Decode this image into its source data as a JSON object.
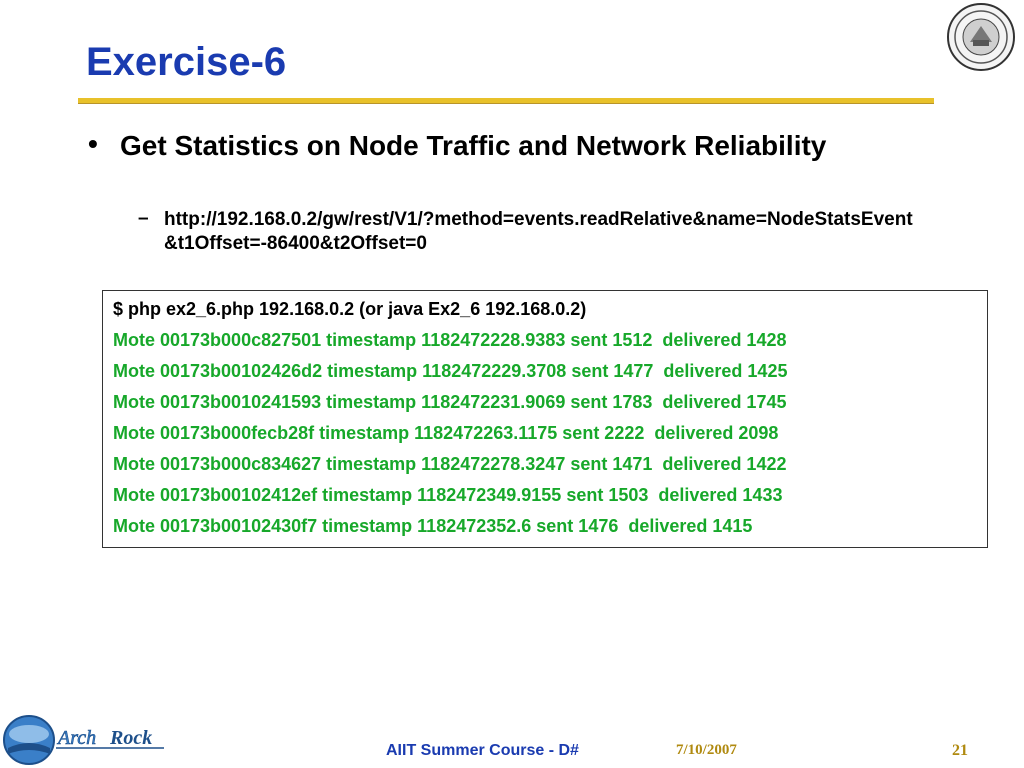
{
  "slide": {
    "title": "Exercise-6",
    "bullet": "Get Statistics on Node Traffic and Network Reliability",
    "sub_bullet": "http://192.168.0.2/gw/rest/V1/?method=events.readRelative&name=NodeStatsEvent&t1Offset=-86400&t2Offset=0"
  },
  "code": {
    "command": "$ php ex2_6.php 192.168.0.2 (or java Ex2_6 192.168.0.2)",
    "lines": [
      "Mote 00173b000c827501 timestamp 1182472228.9383 sent 1512  delivered 1428",
      "Mote 00173b00102426d2 timestamp 1182472229.3708 sent 1477  delivered 1425",
      "Mote 00173b0010241593 timestamp 1182472231.9069 sent 1783  delivered 1745",
      "Mote 00173b000fecb28f timestamp 1182472263.1175 sent 2222  delivered 2098",
      "Mote 00173b000c834627 timestamp 1182472278.3247 sent 1471  delivered 1422",
      "Mote 00173b00102412ef timestamp 1182472349.9155 sent 1503  delivered 1433",
      "Mote 00173b00102430f7 timestamp 1182472352.6 sent 1476  delivered 1415"
    ]
  },
  "footer": {
    "logo_text_prefix": "Arch",
    "logo_text_suffix": "Rock",
    "course": "AIIT Summer Course - D#",
    "date": "7/10/2007",
    "page": "21"
  },
  "icons": {
    "seal": "university-seal-icon",
    "logo": "archrock-logo-icon"
  },
  "colors": {
    "title": "#1a3bb0",
    "rule": "#e8c12a",
    "output_text": "#17a82a",
    "footer_date": "#b08a10"
  }
}
